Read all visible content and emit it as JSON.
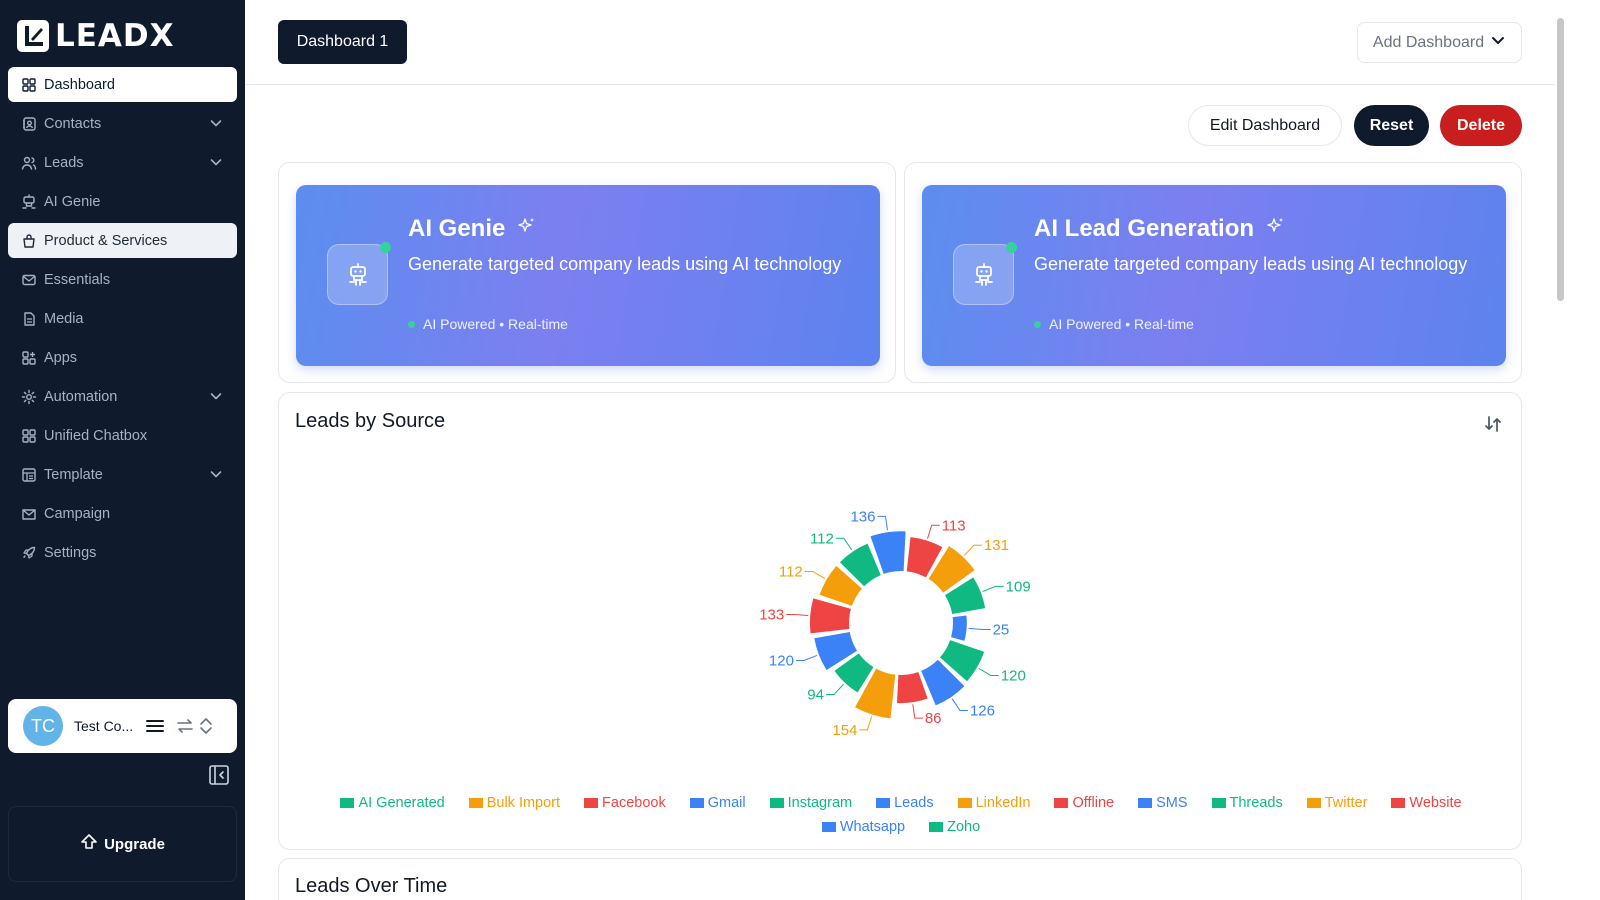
{
  "brand": {
    "name": "LEADX"
  },
  "sidebar": {
    "items": [
      {
        "label": "Dashboard",
        "icon": "grid-icon",
        "state": "active",
        "chevron": false
      },
      {
        "label": "Contacts",
        "icon": "contacts-icon",
        "state": "",
        "chevron": true
      },
      {
        "label": "Leads",
        "icon": "users-icon",
        "state": "",
        "chevron": true
      },
      {
        "label": "AI Genie",
        "icon": "robot-icon",
        "state": "",
        "chevron": false
      },
      {
        "label": "Product & Services",
        "icon": "bag-icon",
        "state": "hover",
        "chevron": false
      },
      {
        "label": "Essentials",
        "icon": "mail-icon",
        "state": "",
        "chevron": false
      },
      {
        "label": "Media",
        "icon": "file-icon",
        "state": "",
        "chevron": false
      },
      {
        "label": "Apps",
        "icon": "apps-icon",
        "state": "",
        "chevron": false
      },
      {
        "label": "Automation",
        "icon": "gear-icon",
        "state": "",
        "chevron": true
      },
      {
        "label": "Unified Chatbox",
        "icon": "grid-icon",
        "state": "",
        "chevron": false
      },
      {
        "label": "Template",
        "icon": "template-icon",
        "state": "",
        "chevron": true
      },
      {
        "label": "Campaign",
        "icon": "campaign-mail-icon",
        "state": "",
        "chevron": false
      },
      {
        "label": "Settings",
        "icon": "rocket-icon",
        "state": "",
        "chevron": false
      }
    ],
    "user": {
      "initials": "TC",
      "name": "Test Co..."
    },
    "upgrade_label": "Upgrade"
  },
  "topbar": {
    "active_tab": "Dashboard 1",
    "add_dashboard": "Add Dashboard"
  },
  "actions": {
    "edit": "Edit Dashboard",
    "reset": "Reset",
    "delete": "Delete"
  },
  "promos": [
    {
      "title": "AI Genie",
      "description": "Generate targeted company leads using AI technology",
      "meta": "AI Powered • Real-time"
    },
    {
      "title": "AI Lead Generation",
      "description": "Generate targeted company leads using AI technology",
      "meta": "AI Powered • Real-time"
    }
  ],
  "colors": {
    "sidebar_bg": "#0f1b2d",
    "green": "#10b981",
    "orange": "#f59e0b",
    "red": "#ef4444",
    "blue": "#3b82f6",
    "delete": "#c81e1e"
  },
  "legend": [
    {
      "name": "AI Generated",
      "color": "#10b981"
    },
    {
      "name": "Bulk Import",
      "color": "#f59e0b"
    },
    {
      "name": "Facebook",
      "color": "#ef4444"
    },
    {
      "name": "Gmail",
      "color": "#3b82f6"
    },
    {
      "name": "Instagram",
      "color": "#10b981"
    },
    {
      "name": "Leads",
      "color": "#3b82f6"
    },
    {
      "name": "LinkedIn",
      "color": "#f59e0b"
    },
    {
      "name": "Offline",
      "color": "#ef4444"
    },
    {
      "name": "SMS",
      "color": "#3b82f6"
    },
    {
      "name": "Threads",
      "color": "#10b981"
    },
    {
      "name": "Twitter",
      "color": "#f59e0b"
    },
    {
      "name": "Website",
      "color": "#ef4444"
    },
    {
      "name": "Whatsapp",
      "color": "#3b82f6"
    },
    {
      "name": "Zoho",
      "color": "#10b981"
    }
  ],
  "chart_data": {
    "type": "pie",
    "title": "Leads by Source",
    "variant": "nightingale-rose donut",
    "slices": [
      {
        "value": 113,
        "color": "#ef4444"
      },
      {
        "value": 131,
        "color": "#f59e0b"
      },
      {
        "value": 109,
        "color": "#10b981"
      },
      {
        "value": 25,
        "color": "#3b82f6"
      },
      {
        "value": 120,
        "color": "#10b981"
      },
      {
        "value": 126,
        "color": "#3b82f6"
      },
      {
        "value": 86,
        "color": "#ef4444"
      },
      {
        "value": 154,
        "color": "#f59e0b"
      },
      {
        "value": 94,
        "color": "#10b981"
      },
      {
        "value": 120,
        "color": "#3b82f6"
      },
      {
        "value": 133,
        "color": "#ef4444"
      },
      {
        "value": 112,
        "color": "#f59e0b"
      },
      {
        "value": 112,
        "color": "#10b981"
      },
      {
        "value": 136,
        "color": "#3b82f6"
      }
    ]
  },
  "next_card": {
    "title": "Leads Over Time"
  }
}
